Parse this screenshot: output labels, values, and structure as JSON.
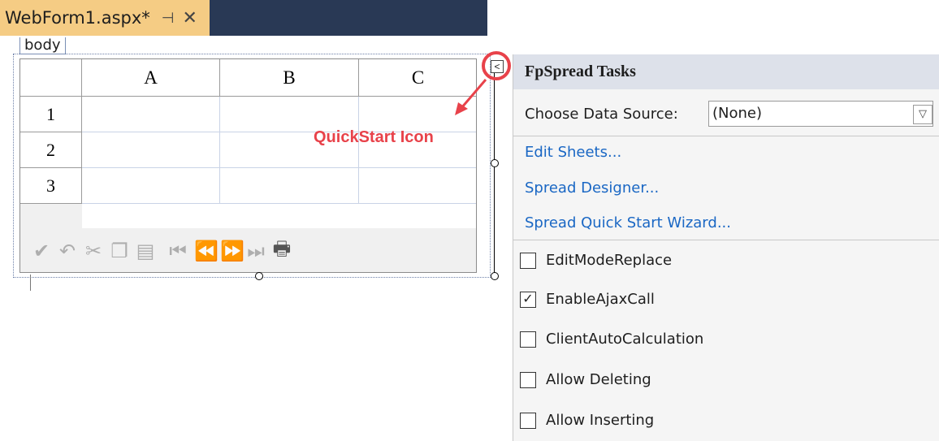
{
  "tab": {
    "title": "WebForm1.aspx*",
    "pin": "⊣",
    "close": "✕"
  },
  "breadcrumb": "body",
  "spread": {
    "columns": [
      "A",
      "B",
      "C"
    ],
    "rows": [
      "1",
      "2",
      "3"
    ]
  },
  "annotation": {
    "label": "QuickStart Icon",
    "button": "<",
    "color": "#e8424a"
  },
  "panel": {
    "title": "FpSpread Tasks",
    "data_source_label": "Choose Data Source:",
    "data_source_value": "(None)",
    "links": [
      "Edit Sheets...",
      "Spread Designer...",
      "Spread Quick Start Wizard..."
    ],
    "checkboxes": [
      {
        "label": "EditModeReplace",
        "checked": false
      },
      {
        "label": "EnableAjaxCall",
        "checked": true
      },
      {
        "label": "ClientAutoCalculation",
        "checked": false
      },
      {
        "label": "Allow Deleting",
        "checked": false
      },
      {
        "label": "Allow Inserting",
        "checked": false
      }
    ]
  },
  "colors": {
    "tab_bg": "#f5cc84",
    "tabstrip_bg": "#293955",
    "link": "#1a67c4"
  }
}
